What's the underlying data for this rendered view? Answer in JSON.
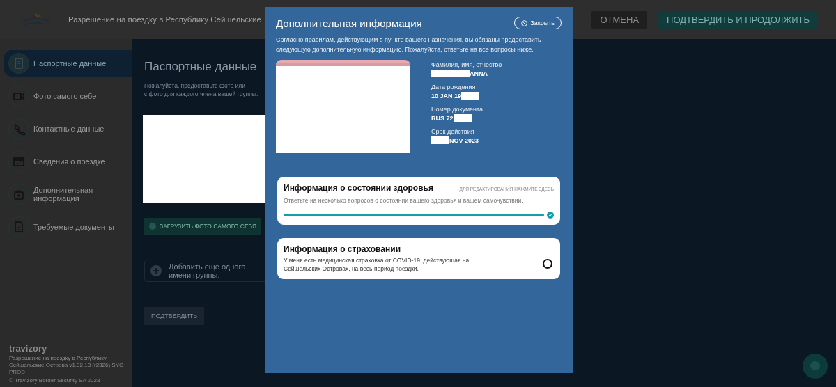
{
  "header": {
    "title": "Разрешение на поездку в Республику Сейшельские",
    "buttons": [
      {
        "label": "ОТМЕНА",
        "kind": "secondary"
      },
      {
        "label": "ПОДТВЕРДИТЬ И ПРОДОЛЖИТЬ",
        "kind": "primary"
      }
    ]
  },
  "sidebar": {
    "items": [
      {
        "label": "Паспортные данные",
        "selected": true
      },
      {
        "label": "Фото самого себе",
        "selected": false
      },
      {
        "label": "Контактные данные",
        "selected": false
      },
      {
        "label": "Сведения о поездке",
        "selected": false
      },
      {
        "label": "Дополнительная информация",
        "selected": false
      },
      {
        "label": "Требуемые документы",
        "selected": false
      }
    ],
    "footer": {
      "brand": "travizory",
      "lines": [
        "Разрешение на поездку в Республику Сейшельские Острова v1.32.13 (r2326) SYC PROD",
        "© Travizory Border Security SA 2023"
      ]
    }
  },
  "main": {
    "title": "Паспортные данные",
    "intro": [
      "Пожалуйста, предоставьте фото или",
      "с фото для каждого члена вашей группы."
    ],
    "upload_button": "ЗАГРУЗИТЬ ФОТО САМОГО СЕБЯ",
    "add_person": [
      "Добавить еще одного",
      "имени группы."
    ],
    "confirm_button": "ПОДТВЕРДИТЬ"
  },
  "modal": {
    "title": "Дополнительная информация",
    "close_button": "Закрыть",
    "description": "Согласно правилам, действующим в пункте вашего назначения, вы обязаны предоставить следующую дополнительную информацию. Пожалуйста, ответьте на все вопросы ниже.",
    "passport_fields": [
      {
        "label": "Фамилия, имя, отчество",
        "value": "ANNA",
        "kind": "prefix_hidden"
      },
      {
        "label": "Дата рождения",
        "value": "10 JAN 19",
        "kind": "suffix_hidden"
      },
      {
        "label": "Номер документа",
        "value": "RUS 72",
        "kind": "suffix_hidden"
      },
      {
        "label": "Срок действия",
        "value": "NOV 2023",
        "kind": "prefix_hidden"
      }
    ],
    "cards": [
      {
        "kind": "progress",
        "title": "Информация о состоянии здоровья",
        "hint": "ДЛЯ РЕДАКТИРОВАНИЯ НАЖМИТЕ ЗДЕСЬ",
        "text": "Ответьте на несколько вопросов о состоянии вашего здоровья и вашем самочувствии.",
        "level": 1.0
      },
      {
        "kind": "radio",
        "title": "Информация о страховании",
        "text": "У меня есть медицинская страховка от COVID-19, действующая на Сейшельских Островах, на весь период поездки.",
        "checked": false
      }
    ]
  }
}
